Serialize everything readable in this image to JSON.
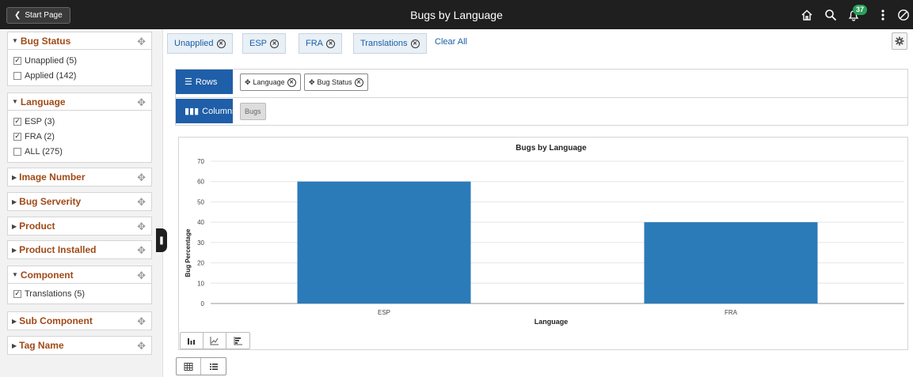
{
  "header": {
    "start_label": "Start Page",
    "title": "Bugs by Language",
    "notification_count": "37",
    "icons": [
      "home-icon",
      "search-icon",
      "bell-icon",
      "more-icon",
      "nav-bar-icon"
    ]
  },
  "sidebar": {
    "facets": [
      {
        "title": "Bug Status",
        "open": true,
        "items": [
          {
            "label": "Unapplied (5)",
            "checked": true
          },
          {
            "label": "Applied (142)",
            "checked": false
          }
        ]
      },
      {
        "title": "Language",
        "open": true,
        "items": [
          {
            "label": "ESP (3)",
            "checked": true
          },
          {
            "label": "FRA (2)",
            "checked": true
          },
          {
            "label": "ALL (275)",
            "checked": false
          }
        ]
      },
      {
        "title": "Image Number",
        "open": false
      },
      {
        "title": "Bug Serverity",
        "open": false
      },
      {
        "title": "Product",
        "open": false
      },
      {
        "title": "Product Installed",
        "open": false
      },
      {
        "title": "Component",
        "open": true,
        "items": [
          {
            "label": "Translations (5)",
            "checked": true
          }
        ]
      },
      {
        "title": "Sub Component",
        "open": false
      },
      {
        "title": "Tag Name",
        "open": false
      }
    ]
  },
  "filters": {
    "chips": [
      "Unapplied",
      "ESP",
      "FRA",
      "Translations"
    ],
    "clear_all": "Clear All"
  },
  "pivot": {
    "rows_label": "Rows",
    "row_fields": [
      "Language",
      "Bug Status"
    ],
    "columns_label": "Columns",
    "column_fields": [
      "Bugs"
    ]
  },
  "chart_data": {
    "type": "bar",
    "title": "Bugs by Language",
    "xlabel": "Language",
    "ylabel": "Bug Percentage",
    "categories": [
      "ESP",
      "FRA"
    ],
    "values": [
      60,
      40
    ],
    "ylim": [
      0,
      70
    ],
    "yticks": [
      0,
      10,
      20,
      30,
      40,
      50,
      60,
      70
    ],
    "bar_color": "#2b7bb9",
    "grid": true
  },
  "colors": {
    "accent": "#1f5ea8",
    "facet_title": "#a04a17",
    "topbar": "#1f1f1f"
  }
}
